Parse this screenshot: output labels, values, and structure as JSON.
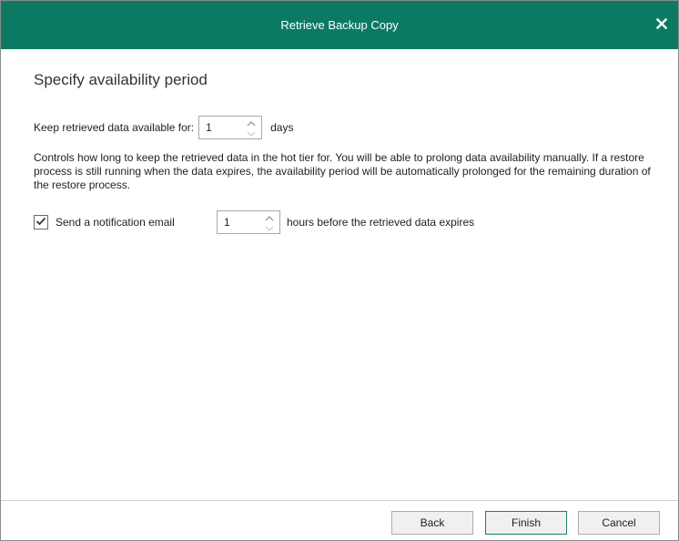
{
  "window": {
    "title": "Retrieve Backup Copy",
    "close_icon": "close-icon"
  },
  "heading": "Specify availability period",
  "availability": {
    "label": "Keep retrieved data available for:",
    "value": "1",
    "unit": "days"
  },
  "description": "Controls how long to keep the retrieved data in the hot tier for. You will be able to prolong data availability manually. If a restore process is still running when the data expires, the availability period will be automatically prolonged for the remaining duration of the restore process.",
  "notification": {
    "checked": true,
    "label": "Send a notification email",
    "value": "1",
    "suffix": "hours before the retrieved data expires"
  },
  "buttons": {
    "back": "Back",
    "finish": "Finish",
    "cancel": "Cancel"
  },
  "colors": {
    "titlebar": "#0c7a63",
    "primary_border": "#1a7f6a"
  }
}
